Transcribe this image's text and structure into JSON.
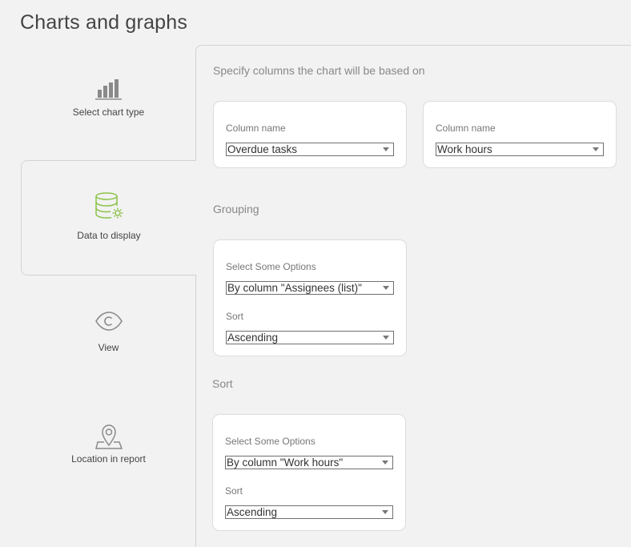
{
  "page": {
    "title": "Charts and graphs"
  },
  "nav": {
    "items": [
      {
        "label": "Select chart type",
        "icon": "bar-chart-icon",
        "active": false
      },
      {
        "label": "Data to display",
        "icon": "database-gear-icon",
        "active": true
      },
      {
        "label": "View",
        "icon": "eye-icon",
        "active": false
      },
      {
        "label": "Location in report",
        "icon": "location-pin-icon",
        "active": false
      }
    ]
  },
  "columns": {
    "heading": "Specify columns the chart will be based on",
    "fields": [
      {
        "label": "Column name",
        "value": "Overdue tasks"
      },
      {
        "label": "Column name",
        "value": "Work hours"
      }
    ]
  },
  "grouping": {
    "heading": "Grouping",
    "options_label": "Select Some Options",
    "options_value": "By column \"Assignees (list)\"",
    "sort_label": "Sort",
    "sort_value": "Ascending"
  },
  "sort": {
    "heading": "Sort",
    "options_label": "Select Some Options",
    "options_value": "By column \"Work hours\"",
    "sort_label": "Sort",
    "sort_value": "Ascending"
  },
  "colors": {
    "accent": "#8bc34a",
    "icon_gray": "#8a8a8a"
  }
}
